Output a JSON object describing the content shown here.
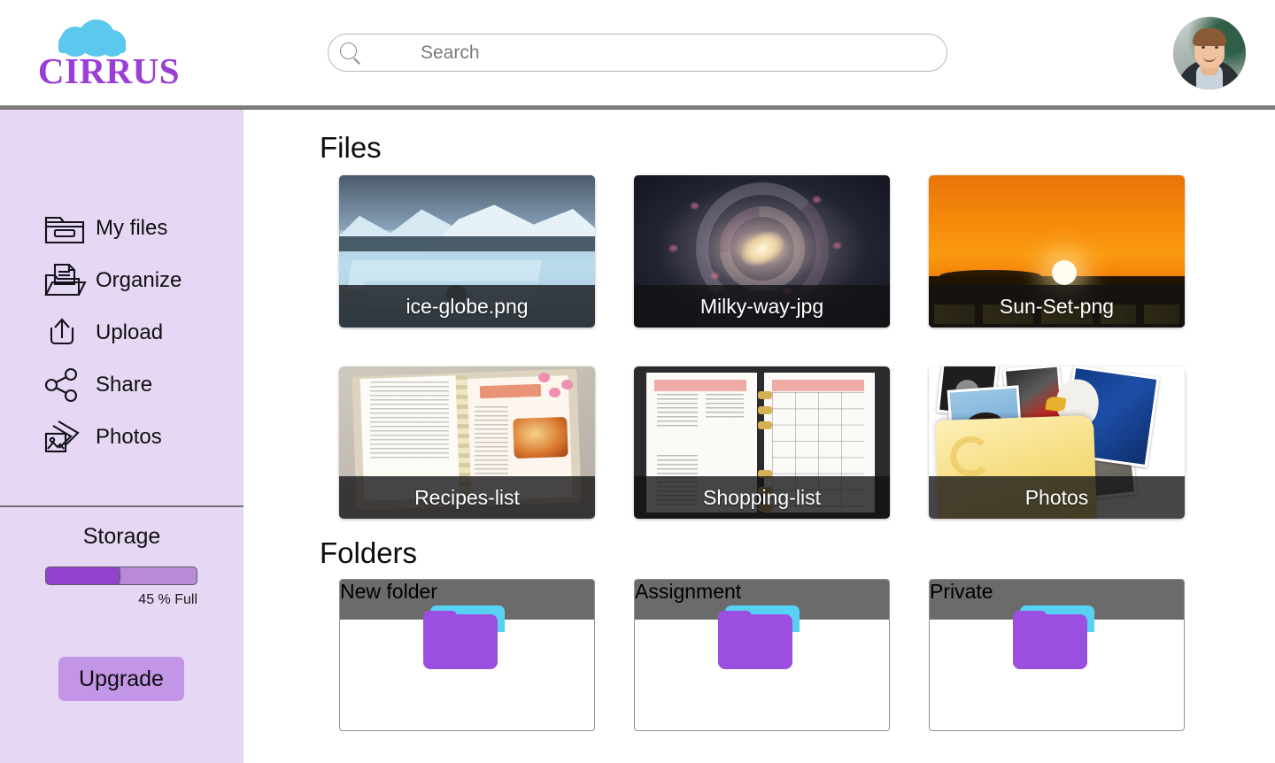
{
  "brand": {
    "name": "CIRRUS",
    "logo_icon": "cloud-icon",
    "cloud_color": "#5bc8ee",
    "text_color": "#9b3fd4"
  },
  "header": {
    "search": {
      "placeholder": "Search",
      "value": "",
      "icon": "search-icon"
    },
    "avatar": {
      "icon": "user-avatar-photo",
      "alt": "Account profile photo"
    }
  },
  "sidebar": {
    "background_color": "#e6d7f5",
    "items": [
      {
        "label": "My files",
        "icon": "folder-files-icon"
      },
      {
        "label": "Organize",
        "icon": "folder-document-icon"
      },
      {
        "label": "Upload",
        "icon": "upload-arrow-icon"
      },
      {
        "label": "Share",
        "icon": "share-nodes-icon"
      },
      {
        "label": "Photos",
        "icon": "photo-stack-icon"
      }
    ],
    "storage": {
      "title": "Storage",
      "percent": 45,
      "percent_label": "45 % Full",
      "fill_color": "#9243cd",
      "track_color": "#b88ad8",
      "upgrade_label": "Upgrade",
      "upgrade_color": "#c295e6"
    }
  },
  "main": {
    "files_section": {
      "title": "Files",
      "items": [
        {
          "label": "ice-globe.png",
          "art": "ice-globe"
        },
        {
          "label": "Milky-way-jpg",
          "art": "milky-way"
        },
        {
          "label": "Sun-Set-png",
          "art": "sun-set"
        },
        {
          "label": "Recipes-list",
          "art": "recipes"
        },
        {
          "label": "Shopping-list",
          "art": "shopping"
        },
        {
          "label": "Photos",
          "art": "photos-folder"
        }
      ]
    },
    "folders_section": {
      "title": "Folders",
      "items": [
        {
          "label": "New folder",
          "icon": "folder-icon"
        },
        {
          "label": "Assignment",
          "icon": "folder-icon"
        },
        {
          "label": "Private",
          "icon": "folder-icon"
        }
      ]
    },
    "folder_colors": {
      "body": "#9a4fe0",
      "tab": "#57d2f2",
      "caption_bar": "#6b6b6b"
    }
  }
}
